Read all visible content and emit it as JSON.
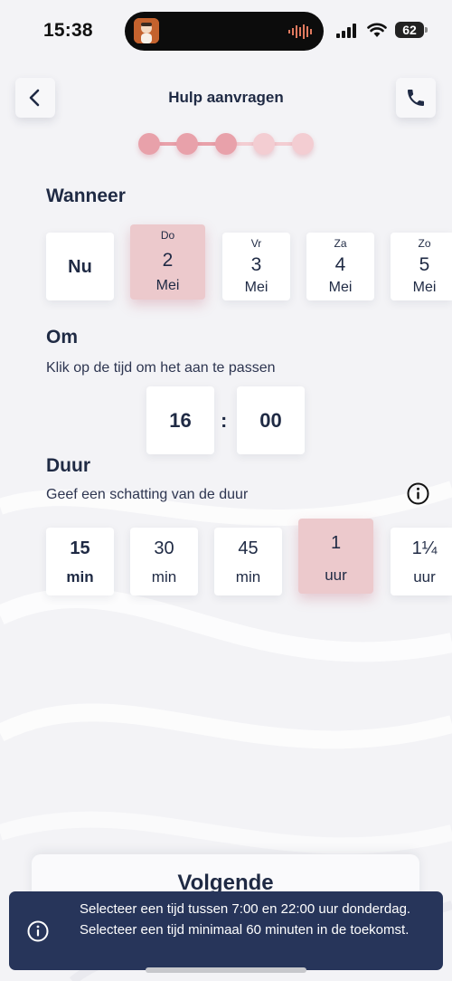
{
  "status_bar": {
    "time": "15:38",
    "battery": "62",
    "icons": [
      "app-avatar-icon",
      "audio-wave-icon",
      "signal-icon",
      "wifi-icon",
      "battery-icon"
    ]
  },
  "header": {
    "title": "Hulp aanvragen",
    "back_icon": "chevron-left-icon",
    "call_icon": "phone-icon"
  },
  "progress": {
    "total_steps": 5,
    "completed_steps": 3,
    "active_color": "#e8a1aa",
    "inactive_color": "#f3cdd2"
  },
  "when": {
    "title": "Wanneer",
    "now_label": "Nu",
    "dates": [
      {
        "dow": "Do",
        "day": "2",
        "month": "Mei",
        "selected": true
      },
      {
        "dow": "Vr",
        "day": "3",
        "month": "Mei",
        "selected": false
      },
      {
        "dow": "Za",
        "day": "4",
        "month": "Mei",
        "selected": false
      },
      {
        "dow": "Zo",
        "day": "5",
        "month": "Mei",
        "selected": false
      }
    ]
  },
  "at": {
    "title": "Om",
    "subtitle": "Klik op de tijd om het aan te passen",
    "hour": "16",
    "separator": ":",
    "minute": "00"
  },
  "duration": {
    "title": "Duur",
    "subtitle": "Geef een schatting van de duur",
    "info_icon": "info-icon",
    "options": [
      {
        "value": "15",
        "unit": "min",
        "selected": false
      },
      {
        "value": "30",
        "unit": "min",
        "selected": false
      },
      {
        "value": "45",
        "unit": "min",
        "selected": false
      },
      {
        "value": "1",
        "unit": "uur",
        "selected": true
      },
      {
        "value": "1¼",
        "unit": "uur",
        "selected": false
      }
    ]
  },
  "next_button": {
    "label": "Volgende"
  },
  "toast": {
    "icon": "info-icon",
    "line1": "Selecteer een tijd tussen 7:00 en 22:00 uur donderdag.",
    "line2": "Selecteer een tijd minimaal 60 minuten in de toekomst."
  },
  "colors": {
    "accent_selected": "#ecc9cc",
    "text_primary": "#1f2a44",
    "toast_bg": "#27355a"
  }
}
